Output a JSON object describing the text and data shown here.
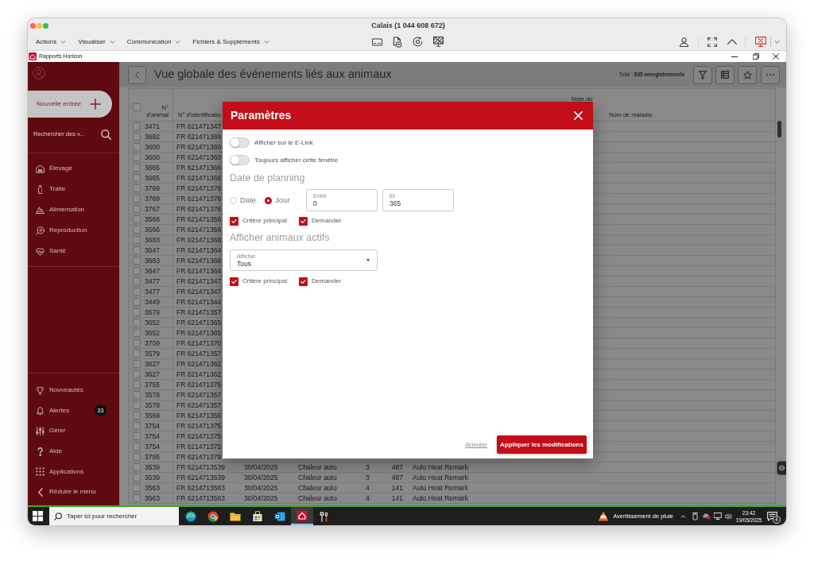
{
  "mac_window": {
    "title": "Calais (1 044 608 672)"
  },
  "toolbar": {
    "menus": [
      "Actions",
      "Visualiser",
      "Communication",
      "Fichiers & Suppléments"
    ]
  },
  "app_window": {
    "title": "Rapports Horizon"
  },
  "sidebar": {
    "new_entry": "Nouvelle entrée",
    "search": {
      "placeholder": "Rechercher des v..."
    },
    "nav_items": [
      {
        "label": "Élevage",
        "selected": false
      },
      {
        "label": "Traite",
        "selected": false
      },
      {
        "label": "Alimentation",
        "selected": false
      },
      {
        "label": "Reproduction",
        "selected": false
      },
      {
        "label": "Santé",
        "selected": false
      }
    ],
    "bottom_items": [
      {
        "label": "Nouveautés"
      },
      {
        "label": "Alertes",
        "badge": "33"
      },
      {
        "label": "Gérer"
      },
      {
        "label": "Aide"
      },
      {
        "label": "Applications"
      },
      {
        "label": "Réduire le menu"
      }
    ]
  },
  "main": {
    "title": "Vue globale des événements liés aux animaux",
    "total": "Total : **835 enregistrements**"
  },
  "table": {
    "select_all_checked": false,
    "columns": [
      "N° d'animal",
      "N° d'identificatio",
      "Nom du",
      "Nom de maladie"
    ],
    "rows": [
      {
        "checked": false,
        "cells": [
          "3471",
          "FR 621471347"
        ]
      },
      {
        "checked": false,
        "cells": [
          "3692",
          "FR 621471369"
        ]
      },
      {
        "checked": false,
        "cells": [
          "3600",
          "FR 621471360"
        ]
      },
      {
        "checked": false,
        "cells": [
          "3600",
          "FR 621471360"
        ]
      },
      {
        "checked": false,
        "cells": [
          "3665",
          "FR 621471366"
        ]
      },
      {
        "checked": false,
        "cells": [
          "3665",
          "FR 621471366"
        ]
      },
      {
        "checked": false,
        "cells": [
          "3769",
          "FR 621471376"
        ]
      },
      {
        "checked": false,
        "cells": [
          "3769",
          "FR 621471376"
        ]
      },
      {
        "checked": false,
        "cells": [
          "3767",
          "FR 621471376"
        ]
      },
      {
        "checked": false,
        "cells": [
          "3566",
          "FR 621471356"
        ]
      },
      {
        "checked": false,
        "cells": [
          "3566",
          "FR 621471356"
        ]
      },
      {
        "checked": false,
        "cells": [
          "3683",
          "FR 621471368"
        ]
      },
      {
        "checked": false,
        "cells": [
          "3647",
          "FR 621471364"
        ]
      },
      {
        "checked": false,
        "cells": [
          "3683",
          "FR 621471368"
        ]
      },
      {
        "checked": false,
        "cells": [
          "3647",
          "FR 621471364"
        ]
      },
      {
        "checked": false,
        "cells": [
          "3477",
          "FR 621471347"
        ]
      },
      {
        "checked": false,
        "cells": [
          "3477",
          "FR 621471347"
        ]
      },
      {
        "checked": false,
        "cells": [
          "3449",
          "FR 621471344"
        ]
      },
      {
        "checked": false,
        "cells": [
          "3579",
          "FR 621471357"
        ]
      },
      {
        "checked": false,
        "cells": [
          "3652",
          "FR 621471365"
        ]
      },
      {
        "checked": false,
        "cells": [
          "3652",
          "FR 621471365"
        ]
      },
      {
        "checked": false,
        "cells": [
          "3709",
          "FR 621471370"
        ]
      },
      {
        "checked": false,
        "cells": [
          "3579",
          "FR 621471357"
        ]
      },
      {
        "checked": false,
        "cells": [
          "3627",
          "FR 621471362"
        ]
      },
      {
        "checked": false,
        "cells": [
          "3627",
          "FR 621471362"
        ]
      },
      {
        "checked": false,
        "cells": [
          "3755",
          "FR 621471375"
        ]
      },
      {
        "checked": false,
        "cells": [
          "3578",
          "FR 621471357"
        ]
      },
      {
        "checked": false,
        "cells": [
          "3578",
          "FR 621471357"
        ]
      },
      {
        "checked": false,
        "cells": [
          "3569",
          "FR 621471356"
        ]
      },
      {
        "checked": false,
        "cells": [
          "3754",
          "FR 621471375"
        ]
      },
      {
        "checked": false,
        "cells": [
          "3754",
          "FR 621471375"
        ]
      },
      {
        "checked": false,
        "cells": [
          "3754",
          "FR 621471375"
        ]
      },
      {
        "checked": false,
        "cells": [
          "3795",
          "FR 621471379"
        ]
      },
      {
        "checked": false,
        "cells": [
          "3539",
          "FR 6214713539",
          "30/04/2025",
          "Chaleur auto",
          "3",
          "487",
          "Auto Heat Remark"
        ]
      },
      {
        "checked": false,
        "cells": [
          "3539",
          "FR 6214713539",
          "30/04/2025",
          "Chaleur auto",
          "3",
          "487",
          "Auto Heat Remark"
        ]
      },
      {
        "checked": false,
        "cells": [
          "3563",
          "FR 6214713563",
          "30/04/2025",
          "Chaleur auto",
          "4",
          "141",
          "Auto Heat Remark"
        ]
      },
      {
        "checked": false,
        "cells": [
          "3563",
          "FR 6214713563",
          "30/04/2025",
          "Chaleur auto",
          "4",
          "141",
          "Auto Heat Remark"
        ]
      }
    ]
  },
  "dialog": {
    "title": "Paramètres",
    "toggles": [
      {
        "label": "Afficher sur le E-Link",
        "on": false
      },
      {
        "label": "Toujours afficher cette fenêtre",
        "on": false
      }
    ],
    "planning": {
      "heading": "Date de planning",
      "radios": [
        {
          "label": "Date",
          "selected": false
        },
        {
          "label": "Jour",
          "selected": true
        }
      ],
      "fields": [
        {
          "label": "Entre",
          "value": "0"
        },
        {
          "label": "Et",
          "value": "365"
        }
      ],
      "checkboxes": [
        {
          "label": "Critère principal",
          "checked": true
        },
        {
          "label": "Demander",
          "checked": true
        }
      ]
    },
    "active_animals": {
      "heading": "Afficher animaux actifs",
      "select": {
        "label": "Afficher",
        "value": "Tous"
      },
      "checkboxes": [
        {
          "label": "Critère principal",
          "checked": true
        },
        {
          "label": "Demander",
          "checked": true
        }
      ]
    },
    "cancel": "Annuler",
    "apply": "Appliquer les modifications"
  },
  "taskbar": {
    "search": {
      "placeholder": "Taper ici pour rechercher"
    },
    "apps": [
      {
        "selected": false
      },
      {
        "selected": false
      },
      {
        "selected": false
      },
      {
        "selected": false
      },
      {
        "selected": false
      },
      {
        "selected": true
      },
      {
        "selected": false
      }
    ],
    "weather": "Avertissement de pluie",
    "time": "23:42",
    "date": "19/05/2025",
    "notifications": "4"
  }
}
